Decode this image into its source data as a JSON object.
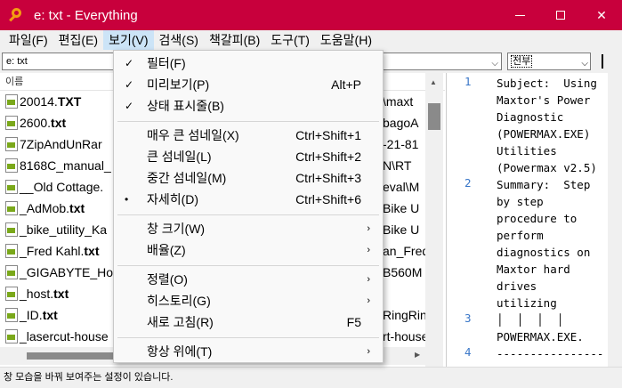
{
  "window": {
    "title": "e: txt - Everything"
  },
  "menubar": {
    "items": [
      "파일(F)",
      "편집(E)",
      "보기(V)",
      "검색(S)",
      "책갈피(B)",
      "도구(T)",
      "도움말(H)"
    ]
  },
  "search": {
    "value": "e: txt",
    "filter": "전부"
  },
  "list": {
    "column": "이름",
    "rows": [
      {
        "name": "20014.",
        "ext": "TXT",
        "path": "\\maxt"
      },
      {
        "name": "2600.",
        "ext": "txt",
        "path": "bagoA"
      },
      {
        "name": "7ZipAndUnRar",
        "ext": "",
        "path": "-21-81"
      },
      {
        "name": "8168C_manual_",
        "ext": "",
        "path": "N\\RT"
      },
      {
        "name": "__Old Cottage.",
        "ext": "",
        "path": "eval\\M"
      },
      {
        "name": "_AdMob.",
        "ext": "txt",
        "path": "Bike U"
      },
      {
        "name": "_bike_utility_Ka",
        "ext": "",
        "path": "Bike U"
      },
      {
        "name": "_Fred Kahl.",
        "ext": "txt",
        "path": "an_Fred"
      },
      {
        "name": "_GIGABYTE_Ho",
        "ext": "",
        "path": "B560M"
      },
      {
        "name": "_host.",
        "ext": "txt",
        "path": ""
      },
      {
        "name": "_ID.",
        "ext": "txt",
        "path": "RingRin"
      },
      {
        "name": "_lasercut-house",
        "ext": "",
        "path": "rt-house"
      }
    ]
  },
  "preview": {
    "lines": [
      {
        "num": "1",
        "text": "Subject:  Using\nMaxtor's Power\nDiagnostic\n(POWERMAX.EXE)\nUtilities\n(Powermax v2.5)"
      },
      {
        "num": "2",
        "text": "Summary:  Step\nby step\nprocedure to\nperform\ndiagnostics on\nMaxtor hard\ndrives\nutilizing"
      },
      {
        "num": "3",
        "text": "│  │  │  │\nPOWERMAX.EXE."
      },
      {
        "num": "4",
        "text": "----------------"
      }
    ]
  },
  "view_menu": {
    "items": [
      {
        "label": "필터(F)",
        "check": "✓",
        "shortcut": "",
        "sub": ""
      },
      {
        "label": "미리보기(P)",
        "check": "✓",
        "shortcut": "Alt+P",
        "sub": ""
      },
      {
        "label": "상태 표시줄(B)",
        "check": "✓",
        "shortcut": "",
        "sub": ""
      },
      {
        "label": "매우 큰 섬네일(X)",
        "check": "",
        "shortcut": "Ctrl+Shift+1",
        "sub": ""
      },
      {
        "label": "큰 섬네일(L)",
        "check": "",
        "shortcut": "Ctrl+Shift+2",
        "sub": ""
      },
      {
        "label": "중간 섬네일(M)",
        "check": "",
        "shortcut": "Ctrl+Shift+3",
        "sub": ""
      },
      {
        "label": "자세히(D)",
        "check": "•",
        "shortcut": "Ctrl+Shift+6",
        "sub": ""
      },
      {
        "label": "창 크기(W)",
        "check": "",
        "shortcut": "",
        "sub": "›"
      },
      {
        "label": "배율(Z)",
        "check": "",
        "shortcut": "",
        "sub": "›"
      },
      {
        "label": "정렬(O)",
        "check": "",
        "shortcut": "",
        "sub": "›"
      },
      {
        "label": "히스토리(G)",
        "check": "",
        "shortcut": "",
        "sub": "›"
      },
      {
        "label": "새로 고침(R)",
        "check": "",
        "shortcut": "F5",
        "sub": ""
      },
      {
        "label": "항상 위에(T)",
        "check": "",
        "shortcut": "",
        "sub": "›"
      }
    ]
  },
  "status": {
    "text": "창 모습을 바꿔 보여주는 설정이 있습니다."
  },
  "colors": {
    "titlebar": "#c8003c",
    "menu_highlight": "#cce4f7",
    "line_number": "#3a77c8"
  }
}
